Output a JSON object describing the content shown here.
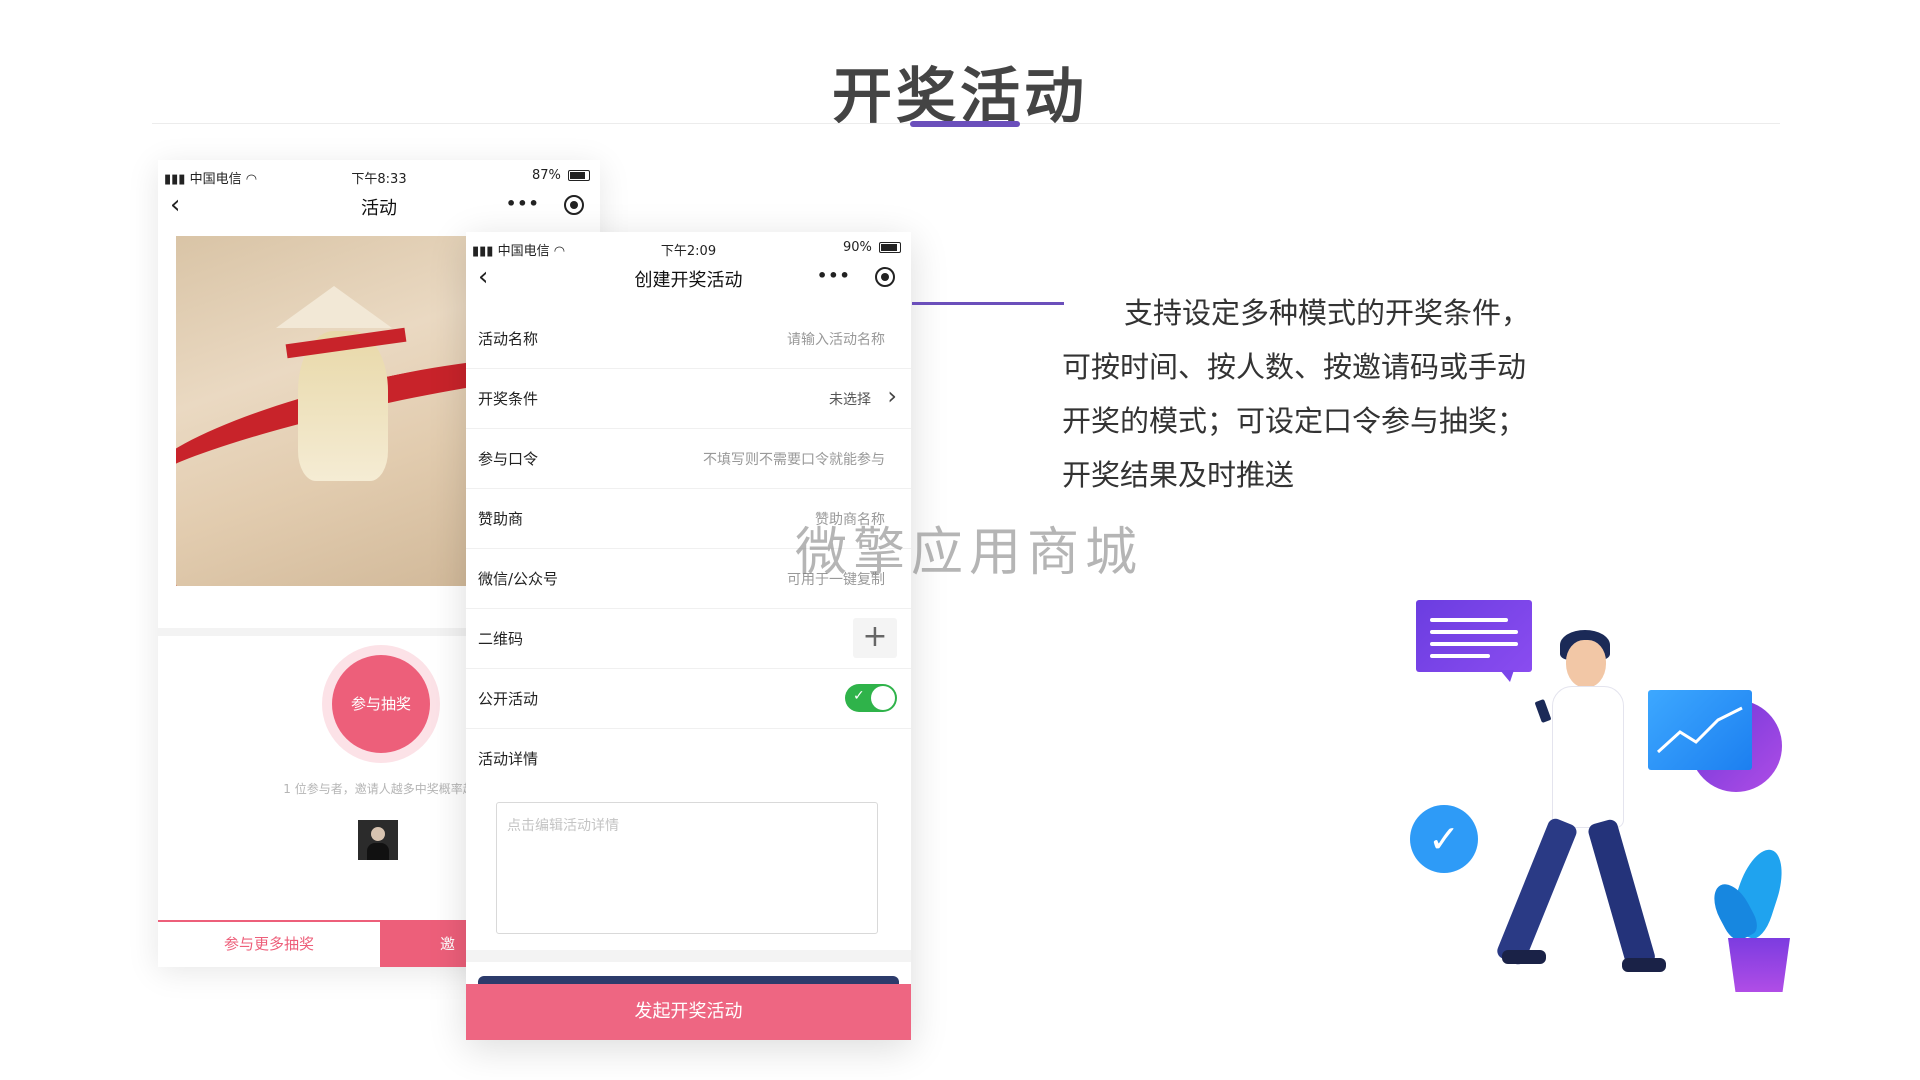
{
  "page": {
    "title": "开奖活动",
    "description": [
      "支持设定多种模式的开奖条件，",
      "可按时间、按人数、按邀请码或手动",
      "开奖的模式；可设定口令参与抽奖；",
      "开奖结果及时推送"
    ],
    "watermark": "微擎应用商城"
  },
  "phone1": {
    "status": {
      "carrier": "中国电信",
      "time": "下午8:33",
      "battery": "87%"
    },
    "nav_title": "活动",
    "join_button": "参与抽奖",
    "hint": "1 位参与者，邀请人越多中奖概率越",
    "more_button": "参与更多抽奖",
    "invite_button": "邀"
  },
  "phone2": {
    "status": {
      "carrier": "中国电信",
      "time": "下午2:09",
      "battery": "90%"
    },
    "nav_title": "创建开奖活动",
    "fields": [
      {
        "label": "活动名称",
        "placeholder": "请输入活动名称"
      },
      {
        "label": "开奖条件",
        "value": "未选择"
      },
      {
        "label": "参与口令",
        "placeholder": "不填写则不需要口令就能参与"
      },
      {
        "label": "赞助商",
        "placeholder": "赞助商名称"
      },
      {
        "label": "微信/公众号",
        "placeholder": "可用于一键复制"
      },
      {
        "label": "二维码"
      },
      {
        "label": "公开活动",
        "toggle_on": true
      },
      {
        "label": "活动详情"
      }
    ],
    "detail_placeholder": "点击编辑活动详情",
    "submit_button": "发起开奖活动"
  },
  "colors": {
    "accent": "#6b4fbb",
    "pink": "#ed5f7a",
    "toggle": "#2fb34a"
  }
}
